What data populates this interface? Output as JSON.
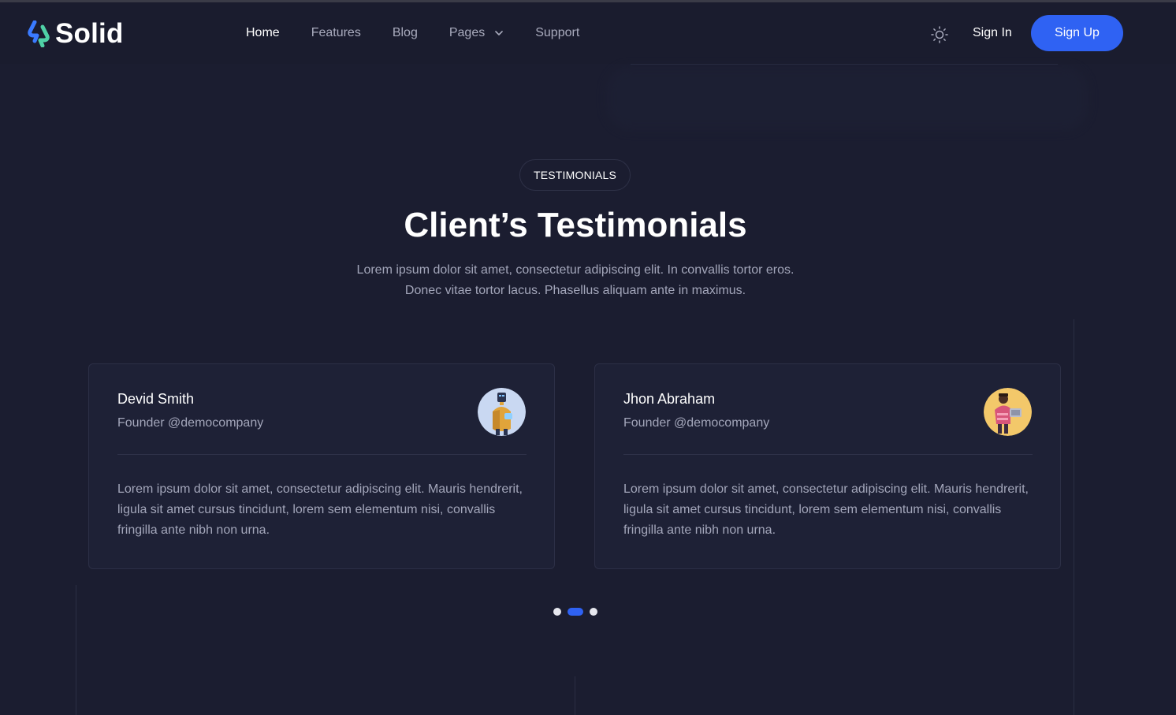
{
  "header": {
    "brand": "Solid",
    "nav": [
      {
        "label": "Home",
        "active": true
      },
      {
        "label": "Features",
        "active": false
      },
      {
        "label": "Blog",
        "active": false
      },
      {
        "label": "Pages",
        "active": false,
        "dropdown": true
      },
      {
        "label": "Support",
        "active": false
      }
    ],
    "theme_icon": "sun-icon",
    "sign_in": "Sign In",
    "sign_up": "Sign Up"
  },
  "testimonials": {
    "badge": "TESTIMONIALS",
    "title": "Client’s Testimonials",
    "subtitle_line1": "Lorem ipsum dolor sit amet, consectetur adipiscing elit. In convallis tortor eros.",
    "subtitle_line2": "Donec vitae tortor lacus. Phasellus aliquam ante in maximus.",
    "cards": [
      {
        "name": "Devid Smith",
        "role": "Founder @democompany",
        "quote": "Lorem ipsum dolor sit amet, consectetur adipiscing elit. Mauris hendrerit, ligula sit amet cursus tincidunt, lorem sem elementum nisi, convallis fringilla ante nibh non urna.",
        "avatar": "avatar-robot"
      },
      {
        "name": "Jhon Abraham",
        "role": "Founder @democompany",
        "quote": "Lorem ipsum dolor sit amet, consectetur adipiscing elit. Mauris hendrerit, ligula sit amet cursus tincidunt, lorem sem elementum nisi, convallis fringilla ante nibh non urna.",
        "avatar": "avatar-person-laptop"
      }
    ],
    "pagination": {
      "total": 3,
      "active_index": 1
    }
  },
  "colors": {
    "background": "#1b1d30",
    "card": "#1e2136",
    "accent": "#2f62f3",
    "muted_text": "#a3a6ba"
  }
}
